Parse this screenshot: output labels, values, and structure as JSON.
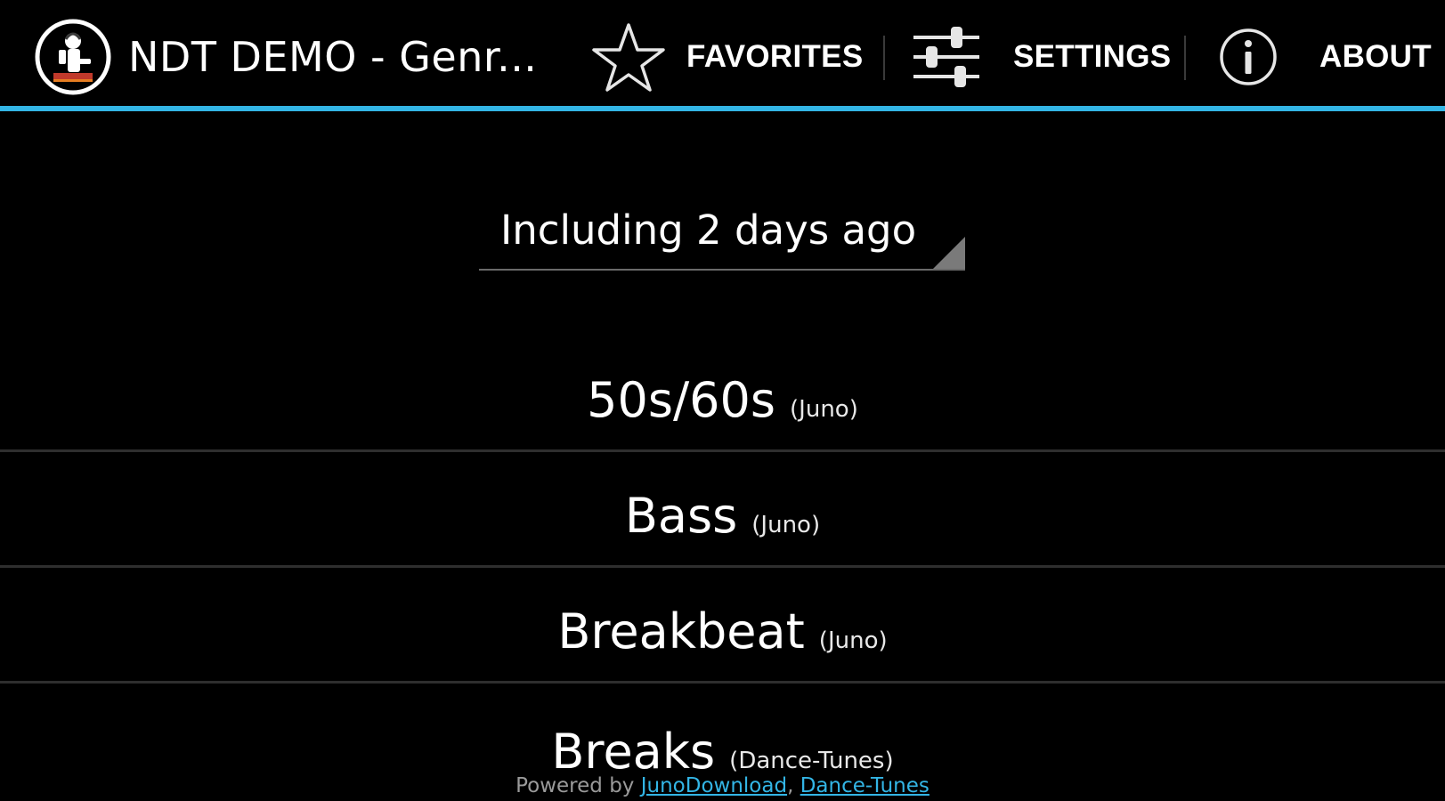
{
  "action_bar": {
    "title": "NDT DEMO - Genr...",
    "accent_color": "#33b5e5",
    "logo_icon": "dj-turntable-icon",
    "actions": [
      {
        "label": "FAVORITES",
        "icon": "star-icon"
      },
      {
        "label": "SETTINGS",
        "icon": "sliders-icon"
      },
      {
        "label": "ABOUT",
        "icon": "info-icon"
      }
    ]
  },
  "date_filter": {
    "selected": "Including 2 days ago"
  },
  "genres": [
    {
      "name": "50s/60s",
      "source": "(Juno)"
    },
    {
      "name": "Bass",
      "source": "(Juno)"
    },
    {
      "name": "Breakbeat",
      "source": "(Juno)"
    },
    {
      "name": "Breaks",
      "source": "(Dance-Tunes)"
    }
  ],
  "footer": {
    "prefix": "Powered by",
    "links": [
      "JunoDownload",
      "Dance-Tunes"
    ],
    "separator": ","
  }
}
